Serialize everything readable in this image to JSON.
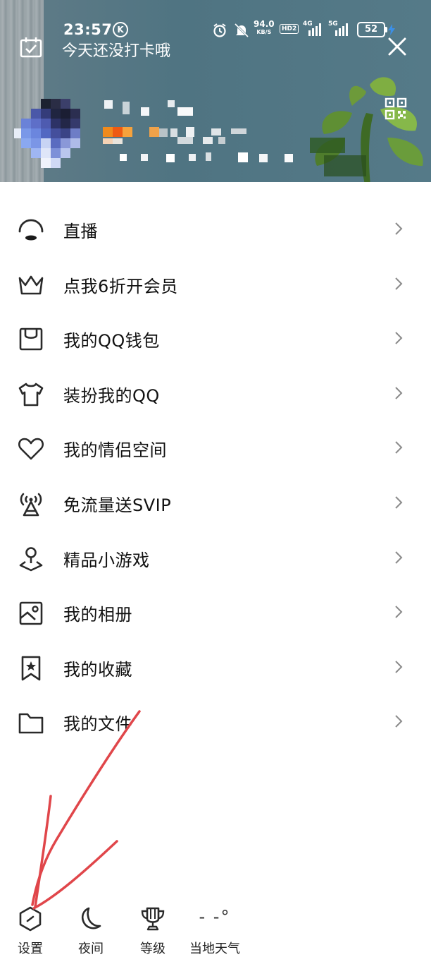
{
  "status_bar": {
    "time": "23:57",
    "carrier_badge": "K",
    "net_speed_value": "94.0",
    "net_speed_unit": "KB/S",
    "hd_badge": "HD2",
    "signal_4g": "4G",
    "signal_5g": "5G",
    "battery": "52"
  },
  "header": {
    "checkin_text": "今天还没打卡哦"
  },
  "menu": {
    "items": [
      {
        "label": "直播",
        "icon": "live-icon"
      },
      {
        "label": "点我6折开会员",
        "icon": "crown-icon"
      },
      {
        "label": "我的QQ钱包",
        "icon": "wallet-icon"
      },
      {
        "label": "装扮我的QQ",
        "icon": "shirt-icon"
      },
      {
        "label": "我的情侣空间",
        "icon": "heart-icon"
      },
      {
        "label": "免流量送SVIP",
        "icon": "antenna-icon"
      },
      {
        "label": "精品小游戏",
        "icon": "game-pin-icon"
      },
      {
        "label": "我的相册",
        "icon": "photo-album-icon"
      },
      {
        "label": "我的收藏",
        "icon": "bookmark-star-icon"
      },
      {
        "label": "我的文件",
        "icon": "folder-icon"
      }
    ]
  },
  "bottom_bar": {
    "settings_label": "设置",
    "night_label": "夜间",
    "level_label": "等级",
    "weather_label": "当地天气",
    "weather_temp": "- -°"
  },
  "colors": {
    "annotation_red": "#e0464a",
    "icon_dark": "#2a2a2a"
  }
}
